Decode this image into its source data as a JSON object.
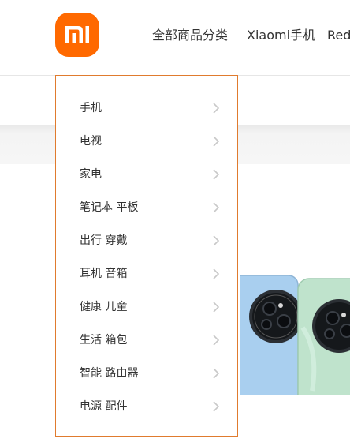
{
  "header": {
    "logo_text": "mi",
    "nav": [
      {
        "label": "全部商品分类"
      },
      {
        "label": "Xiaomi手机"
      },
      {
        "label": "Red"
      }
    ]
  },
  "menu": {
    "items": [
      {
        "label": "手机"
      },
      {
        "label": "电视"
      },
      {
        "label": "家电"
      },
      {
        "label": "笔记本 平板"
      },
      {
        "label": "出行 穿戴"
      },
      {
        "label": "耳机 音箱"
      },
      {
        "label": "健康 儿童"
      },
      {
        "label": "生活 箱包"
      },
      {
        "label": "智能 路由器"
      },
      {
        "label": "电源 配件"
      }
    ]
  },
  "colors": {
    "brand": "#ff6900",
    "menu_border": "#e07b2e",
    "phone_blue": "#a9cfef",
    "phone_green": "#bfe3cc"
  }
}
